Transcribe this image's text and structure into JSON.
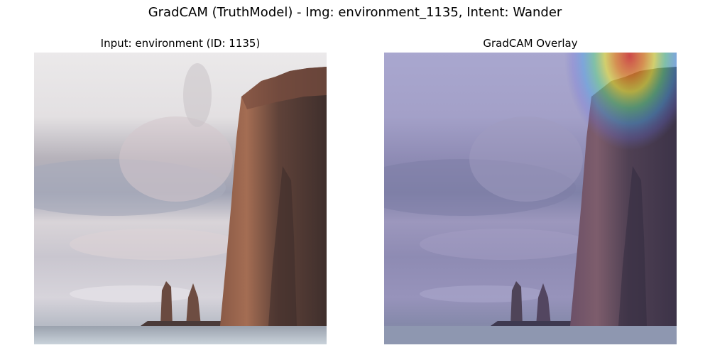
{
  "figure": {
    "title": "GradCAM (TruthModel) - Img: environment_1135, Intent: Wander"
  },
  "panels": [
    {
      "title": "Input: environment (ID: 1135)"
    },
    {
      "title": "GradCAM Overlay"
    }
  ],
  "colors": {
    "sky": "#e6e3e6",
    "cloud_band": "#8e93a8",
    "cliff": "#5e3f36",
    "cliff_lit": "#a06a52",
    "sea": "#c7d0d8",
    "overlay_tint": "#6b6fc8"
  }
}
